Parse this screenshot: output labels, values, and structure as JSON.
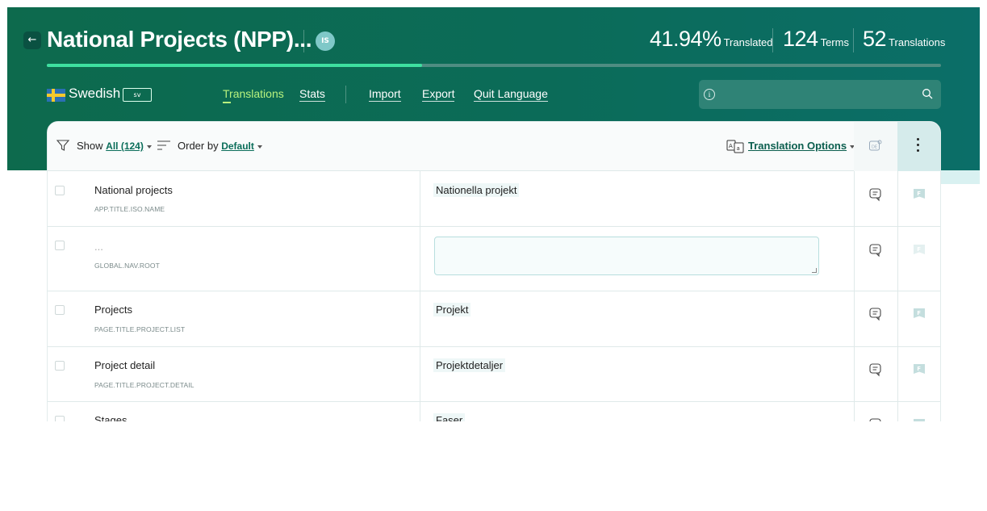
{
  "header": {
    "back_icon": "arrow-left-icon",
    "title": "National Projects (NPP)...",
    "owner_badge": "IS",
    "progress_fraction": 0.4194,
    "stats": [
      {
        "value": "41.94%",
        "label": "Translated"
      },
      {
        "value": "124",
        "label": "Terms"
      },
      {
        "value": "52",
        "label": "Translations"
      }
    ]
  },
  "language": {
    "flag_icon": "sweden-flag-icon",
    "name": "Swedish",
    "code": "sv"
  },
  "nav": {
    "translations": "Translations",
    "stats": "Stats",
    "import": "Import",
    "export": "Export",
    "quit": "Quit Language"
  },
  "search": {
    "placeholder": "",
    "info_icon": "info-icon",
    "search_icon": "search-icon"
  },
  "toolbar": {
    "show_label": "Show",
    "show_value": "All (124)",
    "order_label": "Order by",
    "order_value": "Default",
    "translation_options": "Translation Options"
  },
  "rows": [
    {
      "source": "National projects",
      "key": "APP.TITLE.ISO.NAME",
      "translation": "Nationella projekt"
    },
    {
      "source": "...",
      "key": "GLOBAL.NAV.ROOT",
      "translation": ""
    },
    {
      "source": "Projects",
      "key": "PAGE.TITLE.PROJECT.LIST",
      "translation": "Projekt"
    },
    {
      "source": "Project detail",
      "key": "PAGE.TITLE.PROJECT.DETAIL",
      "translation": "Projektdetaljer"
    },
    {
      "source": "Stages",
      "key": "",
      "translation": "Faser"
    }
  ],
  "colors": {
    "header_bg": "#0b6b58",
    "progress": "#3ee0a0",
    "active_nav": "#b8f27e",
    "link": "#0b6e5a"
  }
}
